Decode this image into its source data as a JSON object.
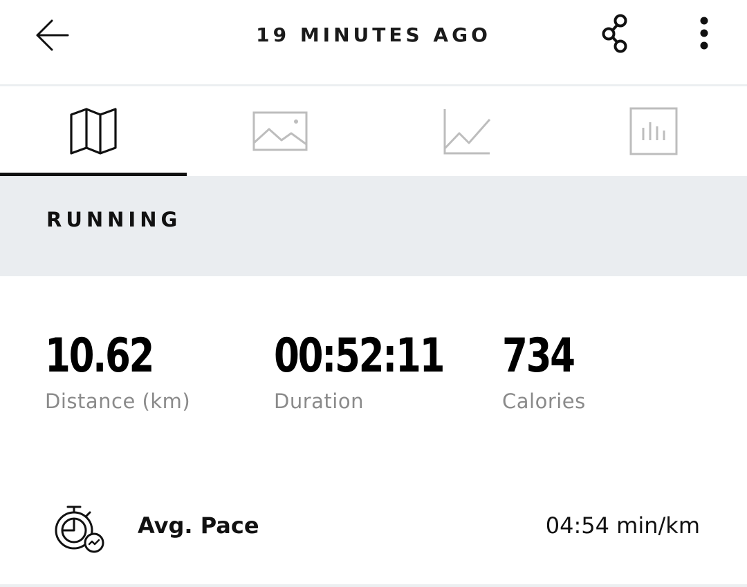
{
  "header": {
    "title": "19 MINUTES AGO",
    "back_icon": "arrow-left-icon",
    "share_icon": "share-icon",
    "more_icon": "more-vertical-icon"
  },
  "tabs": [
    {
      "icon": "map-icon",
      "active": true
    },
    {
      "icon": "image-icon",
      "active": false
    },
    {
      "icon": "line-chart-icon",
      "active": false
    },
    {
      "icon": "bar-chart-icon",
      "active": false
    }
  ],
  "activity": {
    "type": "RUNNING"
  },
  "stats": [
    {
      "value": "10.62",
      "label": "Distance (km)"
    },
    {
      "value": "00:52:11",
      "label": "Duration"
    },
    {
      "value": "734",
      "label": "Calories"
    }
  ],
  "pace": {
    "icon": "stopwatch-icon",
    "label": "Avg. Pace",
    "value": "04:54 min/km"
  },
  "colors": {
    "active_tab": "#111111",
    "inactive_tab": "#bdbdbd",
    "band_background": "#eaedf0",
    "label_gray": "#8a8a8a"
  }
}
